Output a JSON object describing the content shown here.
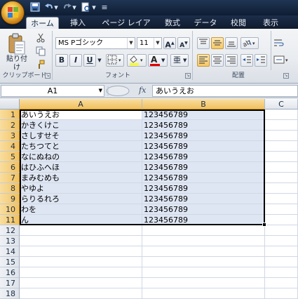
{
  "quick_access": {
    "save_icon": "save-icon",
    "undo_icon": "undo-icon",
    "redo_icon": "redo-icon",
    "dropdown_icon": "customize-dropdown-icon"
  },
  "tabs": [
    "ホーム",
    "挿入",
    "ページ レイアウト",
    "数式",
    "データ",
    "校閲",
    "表示"
  ],
  "ribbon": {
    "clipboard": {
      "paste_label": "貼り付け",
      "group_label": "クリップボード"
    },
    "font": {
      "font_name": "MS Pゴシック",
      "font_size": "11",
      "bold": "B",
      "italic": "I",
      "underline": "U",
      "grow": "A",
      "shrink": "A",
      "font_color": "A",
      "phonetic": "亜",
      "group_label": "フォント"
    },
    "alignment": {
      "group_label": "配置"
    }
  },
  "formula_bar": {
    "name_box": "A1",
    "fx_label": "fx",
    "content": "あいうえお"
  },
  "sheet": {
    "columns": [
      "A",
      "B",
      "C"
    ],
    "rows": [
      "1",
      "2",
      "3",
      "4",
      "5",
      "6",
      "7",
      "8",
      "9",
      "10",
      "11",
      "12",
      "13",
      "14",
      "15",
      "16",
      "17",
      "18"
    ],
    "data": [
      [
        "あいうえお",
        "123456789"
      ],
      [
        "かきくけこ",
        "123456789"
      ],
      [
        "さしすせそ",
        "123456789"
      ],
      [
        "たちつてと",
        "123456789"
      ],
      [
        "なにぬねの",
        "123456789"
      ],
      [
        "はひふへほ",
        "123456789"
      ],
      [
        "まみむめも",
        "123456789"
      ],
      [
        "やゆよ",
        "123456789"
      ],
      [
        "らりるれろ",
        "123456789"
      ],
      [
        "わを",
        "123456789"
      ],
      [
        "ん",
        "123456789"
      ]
    ]
  },
  "colors": {
    "accent": "#f1c15f",
    "selection": "#dfe6f3",
    "titlebar": "#1f3553"
  }
}
